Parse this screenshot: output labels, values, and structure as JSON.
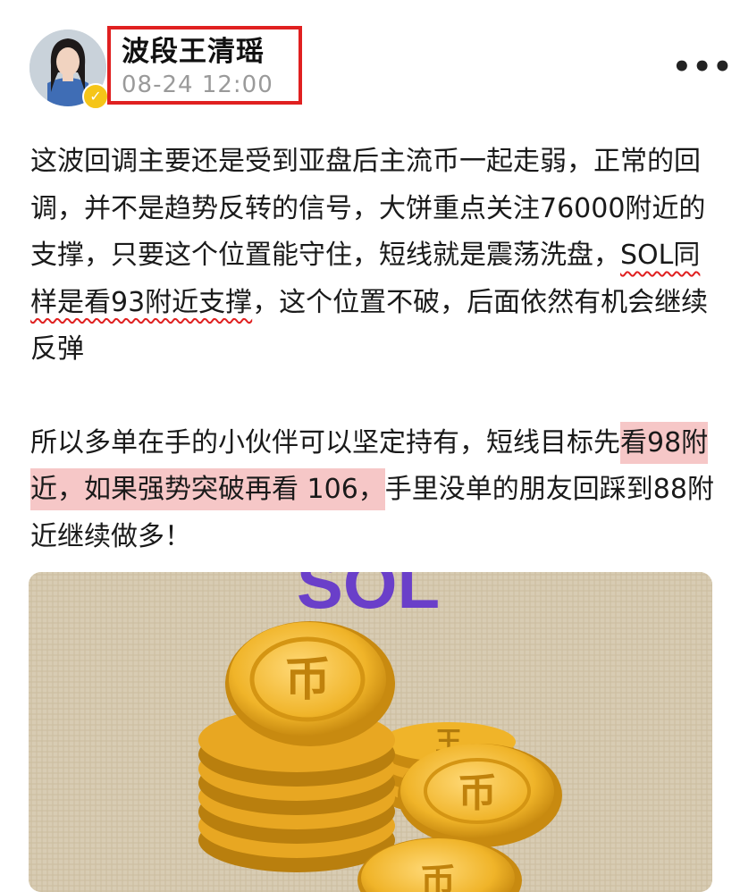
{
  "author": {
    "name": "波段王清瑶",
    "time": "08-24 12:00"
  },
  "post": {
    "p1_before": "这波回调主要还是受到亚盘后主流币一起走弱，正常的回调，并不是趋势反转的信号，大饼重点关注76000附近的支撑，只要这个位置能守住，短线就是震荡洗盘，",
    "p1_wavy": "SOL同样是看93附近支撑",
    "p1_after": "，这个位置不破，后面依然有机会继续反弹",
    "p2_before": "所以多单在手的小伙伴可以坚定持有，短线目标先",
    "p2_highlight": "看98附近，如果强势突破再看 106，",
    "p2_after": "手里没单的朋友回踩到88附近继续做多！"
  },
  "media": {
    "banner_text": "SOL",
    "coin_glyph": "币"
  },
  "icons": {
    "more": "more-dots-icon",
    "verified": "verified-check-icon"
  },
  "colors": {
    "annotation_red": "#e02020",
    "highlight": "#f6c7c7",
    "banner_purple": "#6a3fc9",
    "coin_gold": "#f0b429"
  }
}
